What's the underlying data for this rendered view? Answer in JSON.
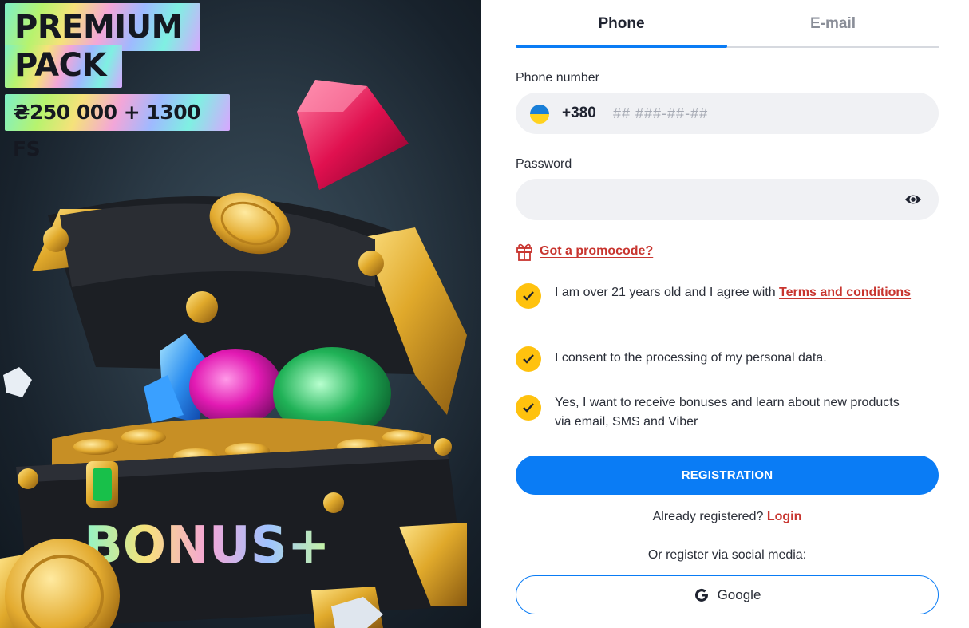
{
  "promo": {
    "title_line1": "PREMIUM",
    "title_line2": "PACK",
    "amount": "₴250 000 + 1300 FS",
    "chest_text": "BONUS+"
  },
  "tabs": {
    "phone": "Phone",
    "email": "E-mail",
    "active": "phone"
  },
  "phone": {
    "label": "Phone number",
    "country_flag": "ukraine-flag",
    "dial_code": "+380",
    "placeholder": "## ###-##-##",
    "value": ""
  },
  "password": {
    "label": "Password",
    "value": "",
    "toggle_icon": "eye-icon"
  },
  "promocode": {
    "icon": "gift-icon",
    "label": "Got a promocode?"
  },
  "consents": [
    {
      "checked": true,
      "text": "I am over 21 years old and I agree with ",
      "link": "Terms and conditions"
    },
    {
      "checked": true,
      "text": "I consent to the processing of my personal data."
    },
    {
      "checked": true,
      "text": "Yes, I want to receive bonuses and learn about new products via email, SMS and Viber"
    }
  ],
  "register_button": "REGISTRATION",
  "login": {
    "prompt": "Already registered? ",
    "link": "Login"
  },
  "social": {
    "label": "Or register via social media:",
    "google": "Google"
  },
  "colors": {
    "accent_blue": "#0a7cf5",
    "link_red": "#c8352f",
    "check_yellow": "#ffc20e",
    "field_bg": "#f0f1f4"
  }
}
